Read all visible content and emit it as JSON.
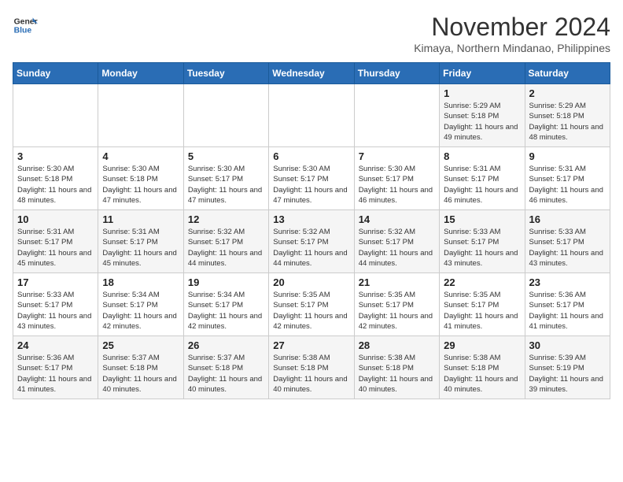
{
  "header": {
    "logo_line1": "General",
    "logo_line2": "Blue",
    "month": "November 2024",
    "location": "Kimaya, Northern Mindanao, Philippines"
  },
  "days_of_week": [
    "Sunday",
    "Monday",
    "Tuesday",
    "Wednesday",
    "Thursday",
    "Friday",
    "Saturday"
  ],
  "weeks": [
    [
      {
        "day": "",
        "info": ""
      },
      {
        "day": "",
        "info": ""
      },
      {
        "day": "",
        "info": ""
      },
      {
        "day": "",
        "info": ""
      },
      {
        "day": "",
        "info": ""
      },
      {
        "day": "1",
        "info": "Sunrise: 5:29 AM\nSunset: 5:18 PM\nDaylight: 11 hours\nand 49 minutes."
      },
      {
        "day": "2",
        "info": "Sunrise: 5:29 AM\nSunset: 5:18 PM\nDaylight: 11 hours\nand 48 minutes."
      }
    ],
    [
      {
        "day": "3",
        "info": "Sunrise: 5:30 AM\nSunset: 5:18 PM\nDaylight: 11 hours\nand 48 minutes."
      },
      {
        "day": "4",
        "info": "Sunrise: 5:30 AM\nSunset: 5:18 PM\nDaylight: 11 hours\nand 47 minutes."
      },
      {
        "day": "5",
        "info": "Sunrise: 5:30 AM\nSunset: 5:17 PM\nDaylight: 11 hours\nand 47 minutes."
      },
      {
        "day": "6",
        "info": "Sunrise: 5:30 AM\nSunset: 5:17 PM\nDaylight: 11 hours\nand 47 minutes."
      },
      {
        "day": "7",
        "info": "Sunrise: 5:30 AM\nSunset: 5:17 PM\nDaylight: 11 hours\nand 46 minutes."
      },
      {
        "day": "8",
        "info": "Sunrise: 5:31 AM\nSunset: 5:17 PM\nDaylight: 11 hours\nand 46 minutes."
      },
      {
        "day": "9",
        "info": "Sunrise: 5:31 AM\nSunset: 5:17 PM\nDaylight: 11 hours\nand 46 minutes."
      }
    ],
    [
      {
        "day": "10",
        "info": "Sunrise: 5:31 AM\nSunset: 5:17 PM\nDaylight: 11 hours\nand 45 minutes."
      },
      {
        "day": "11",
        "info": "Sunrise: 5:31 AM\nSunset: 5:17 PM\nDaylight: 11 hours\nand 45 minutes."
      },
      {
        "day": "12",
        "info": "Sunrise: 5:32 AM\nSunset: 5:17 PM\nDaylight: 11 hours\nand 44 minutes."
      },
      {
        "day": "13",
        "info": "Sunrise: 5:32 AM\nSunset: 5:17 PM\nDaylight: 11 hours\nand 44 minutes."
      },
      {
        "day": "14",
        "info": "Sunrise: 5:32 AM\nSunset: 5:17 PM\nDaylight: 11 hours\nand 44 minutes."
      },
      {
        "day": "15",
        "info": "Sunrise: 5:33 AM\nSunset: 5:17 PM\nDaylight: 11 hours\nand 43 minutes."
      },
      {
        "day": "16",
        "info": "Sunrise: 5:33 AM\nSunset: 5:17 PM\nDaylight: 11 hours\nand 43 minutes."
      }
    ],
    [
      {
        "day": "17",
        "info": "Sunrise: 5:33 AM\nSunset: 5:17 PM\nDaylight: 11 hours\nand 43 minutes."
      },
      {
        "day": "18",
        "info": "Sunrise: 5:34 AM\nSunset: 5:17 PM\nDaylight: 11 hours\nand 42 minutes."
      },
      {
        "day": "19",
        "info": "Sunrise: 5:34 AM\nSunset: 5:17 PM\nDaylight: 11 hours\nand 42 minutes."
      },
      {
        "day": "20",
        "info": "Sunrise: 5:35 AM\nSunset: 5:17 PM\nDaylight: 11 hours\nand 42 minutes."
      },
      {
        "day": "21",
        "info": "Sunrise: 5:35 AM\nSunset: 5:17 PM\nDaylight: 11 hours\nand 42 minutes."
      },
      {
        "day": "22",
        "info": "Sunrise: 5:35 AM\nSunset: 5:17 PM\nDaylight: 11 hours\nand 41 minutes."
      },
      {
        "day": "23",
        "info": "Sunrise: 5:36 AM\nSunset: 5:17 PM\nDaylight: 11 hours\nand 41 minutes."
      }
    ],
    [
      {
        "day": "24",
        "info": "Sunrise: 5:36 AM\nSunset: 5:17 PM\nDaylight: 11 hours\nand 41 minutes."
      },
      {
        "day": "25",
        "info": "Sunrise: 5:37 AM\nSunset: 5:18 PM\nDaylight: 11 hours\nand 40 minutes."
      },
      {
        "day": "26",
        "info": "Sunrise: 5:37 AM\nSunset: 5:18 PM\nDaylight: 11 hours\nand 40 minutes."
      },
      {
        "day": "27",
        "info": "Sunrise: 5:38 AM\nSunset: 5:18 PM\nDaylight: 11 hours\nand 40 minutes."
      },
      {
        "day": "28",
        "info": "Sunrise: 5:38 AM\nSunset: 5:18 PM\nDaylight: 11 hours\nand 40 minutes."
      },
      {
        "day": "29",
        "info": "Sunrise: 5:38 AM\nSunset: 5:18 PM\nDaylight: 11 hours\nand 40 minutes."
      },
      {
        "day": "30",
        "info": "Sunrise: 5:39 AM\nSunset: 5:19 PM\nDaylight: 11 hours\nand 39 minutes."
      }
    ]
  ]
}
